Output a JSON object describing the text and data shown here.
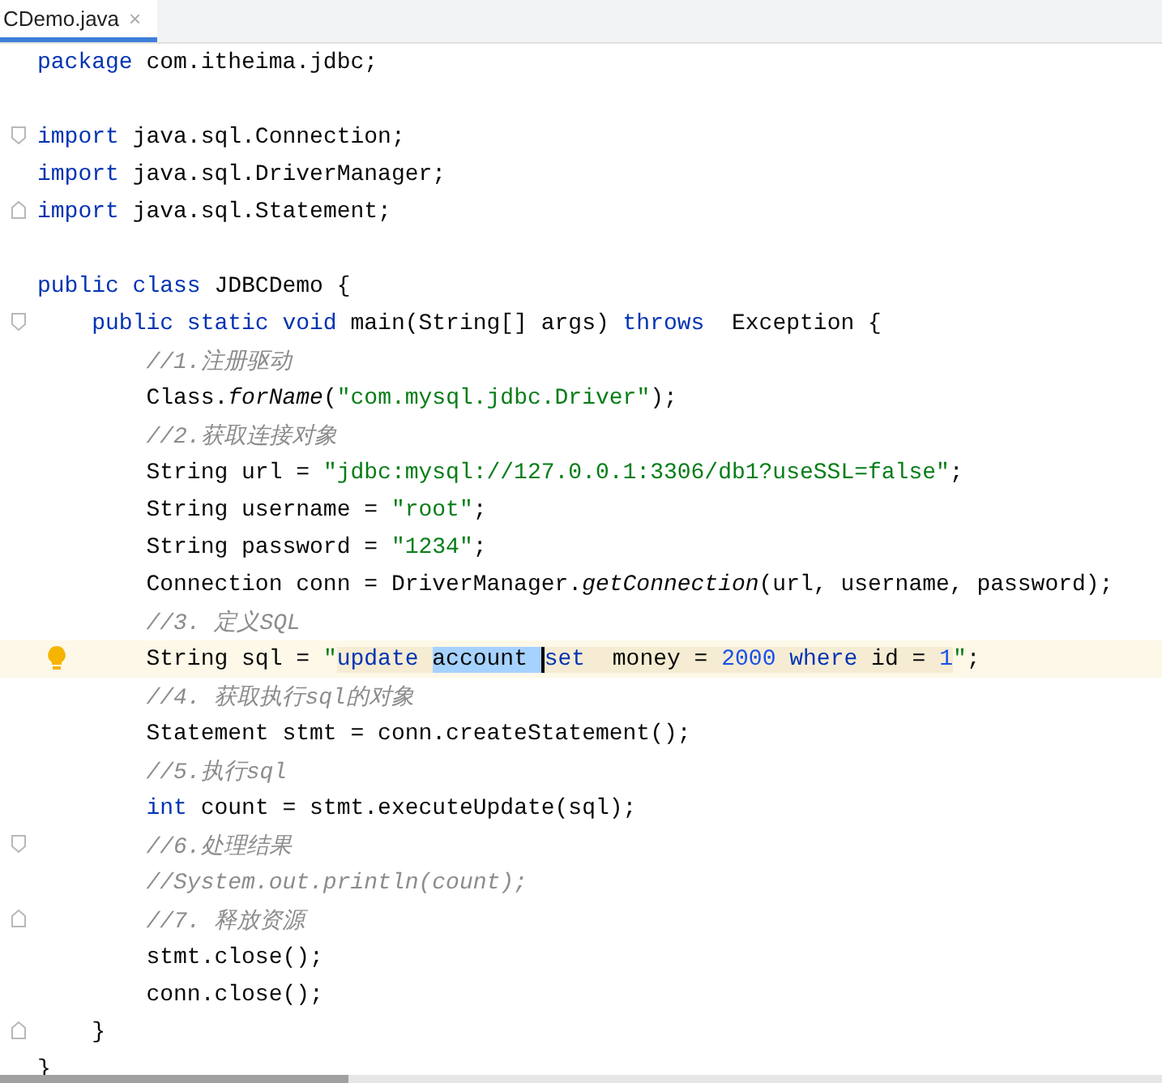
{
  "tab": {
    "title": "CDemo.java",
    "close": "×",
    "selected": true
  },
  "lines": [
    {
      "tokens": [
        {
          "text": "package",
          "kind": "kw"
        },
        {
          "text": " com.itheima.jdbc;",
          "kind": "plain"
        }
      ]
    },
    {
      "blank_before": true,
      "fold_start": true,
      "tokens": [
        {
          "text": "import",
          "kind": "kw"
        },
        {
          "text": " java.sql.Connection;",
          "kind": "plain"
        }
      ]
    },
    {
      "tokens": [
        {
          "text": "import",
          "kind": "kw"
        },
        {
          "text": " java.sql.DriverManager;",
          "kind": "plain"
        }
      ]
    },
    {
      "fold_end": true,
      "tokens": [
        {
          "text": "import",
          "kind": "kw"
        },
        {
          "text": " java.sql.Statement;",
          "kind": "plain"
        }
      ]
    },
    {
      "blank_before": true,
      "tokens": [
        {
          "text": "public class",
          "kind": "kw"
        },
        {
          "text": " JDBCDemo {",
          "kind": "plain"
        }
      ]
    },
    {
      "fold_start": true,
      "tokens": [
        {
          "text": "    public static void",
          "kind": "kw"
        },
        {
          "text": " main(String[] args) ",
          "kind": "plain"
        },
        {
          "text": "throws",
          "kind": "kw"
        },
        {
          "text": "  Exception {",
          "kind": "plain"
        }
      ]
    },
    {
      "tokens": [
        {
          "text": "        //1.注册驱动",
          "kind": "comment"
        }
      ]
    },
    {
      "tokens": [
        {
          "text": "        Class.",
          "kind": "plain"
        },
        {
          "text": "forName",
          "kind": "static"
        },
        {
          "text": "(",
          "kind": "plain"
        },
        {
          "text": "\"com.mysql.jdbc.Driver\"",
          "kind": "string"
        },
        {
          "text": ");",
          "kind": "plain"
        }
      ]
    },
    {
      "tokens": [
        {
          "text": "        //2.获取连接对象",
          "kind": "comment"
        }
      ]
    },
    {
      "tokens": [
        {
          "text": "        String url = ",
          "kind": "plain"
        },
        {
          "text": "\"jdbc:mysql://127.0.0.1:3306/db1?useSSL=false\"",
          "kind": "string"
        },
        {
          "text": ";",
          "kind": "plain"
        }
      ]
    },
    {
      "tokens": [
        {
          "text": "        String username = ",
          "kind": "plain"
        },
        {
          "text": "\"root\"",
          "kind": "string"
        },
        {
          "text": ";",
          "kind": "plain"
        }
      ]
    },
    {
      "tokens": [
        {
          "text": "        String password = ",
          "kind": "plain"
        },
        {
          "text": "\"1234\"",
          "kind": "string"
        },
        {
          "text": ";",
          "kind": "plain"
        }
      ]
    },
    {
      "tokens": [
        {
          "text": "        Connection conn = DriverManager.",
          "kind": "plain"
        },
        {
          "text": "getConnection",
          "kind": "static"
        },
        {
          "text": "(url, username, password);",
          "kind": "plain"
        }
      ]
    },
    {
      "tokens": [
        {
          "text": "        //3. 定义SQL",
          "kind": "comment"
        }
      ]
    },
    {
      "highlighted": true,
      "bulb": true,
      "tokens": [
        {
          "text": "        String sql = ",
          "kind": "plain"
        },
        {
          "text": "\"",
          "kind": "string"
        },
        {
          "text": "update ",
          "kind": "sqlkw"
        },
        {
          "text": "account ",
          "kind": "selected"
        },
        {
          "text": "set",
          "kind": "sqlkw",
          "caret": true
        },
        {
          "text": "  money = ",
          "kind": "sql"
        },
        {
          "text": "2000",
          "kind": "sqlnum"
        },
        {
          "text": " where",
          "kind": "sqlkw"
        },
        {
          "text": " id = ",
          "kind": "sql"
        },
        {
          "text": "1",
          "kind": "sqlnum"
        },
        {
          "text": "\"",
          "kind": "string"
        },
        {
          "text": ";",
          "kind": "plain"
        }
      ]
    },
    {
      "tokens": [
        {
          "text": "        //4. 获取执行sql的对象",
          "kind": "comment"
        }
      ]
    },
    {
      "tokens": [
        {
          "text": "        Statement stmt = conn.createStatement();",
          "kind": "plain"
        }
      ]
    },
    {
      "tokens": [
        {
          "text": "        //5.执行sql",
          "kind": "comment"
        }
      ]
    },
    {
      "tokens": [
        {
          "text": "        int",
          "kind": "kw"
        },
        {
          "text": " count = stmt.executeUpdate(sql);",
          "kind": "plain"
        }
      ]
    },
    {
      "fold_start": true,
      "tokens": [
        {
          "text": "        //6.处理结果",
          "kind": "comment"
        }
      ]
    },
    {
      "tokens": [
        {
          "text": "        //System.out.println(count);",
          "kind": "comment"
        }
      ]
    },
    {
      "fold_end": true,
      "tokens": [
        {
          "text": "        //7. 释放资源",
          "kind": "comment"
        }
      ]
    },
    {
      "tokens": [
        {
          "text": "        stmt.close();",
          "kind": "plain"
        }
      ]
    },
    {
      "tokens": [
        {
          "text": "        conn.close();",
          "kind": "plain"
        }
      ]
    },
    {
      "fold_end": true,
      "tokens": [
        {
          "text": "    }",
          "kind": "plain"
        }
      ]
    },
    {
      "tokens": [
        {
          "text": "}",
          "kind": "plain"
        }
      ]
    }
  ]
}
